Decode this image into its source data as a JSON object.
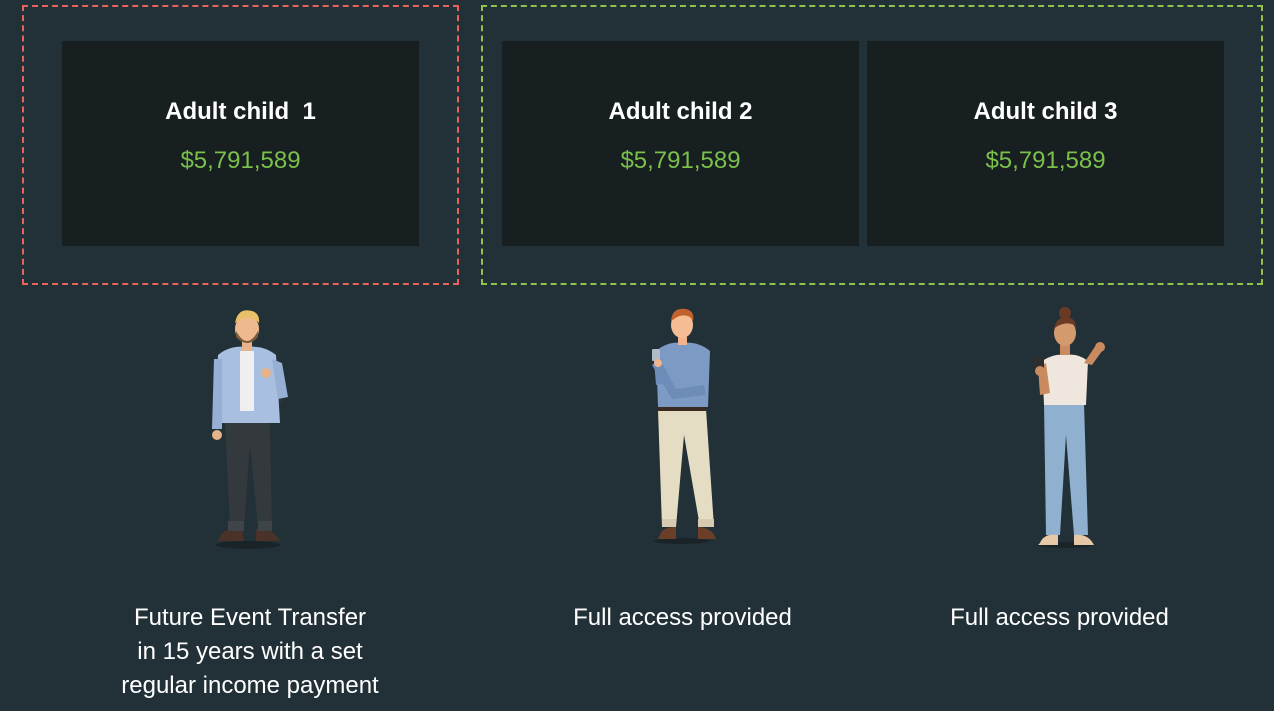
{
  "colors": {
    "background": "#223037",
    "card_background": "#171F21",
    "amount_green": "#7BC04B",
    "dashed_red": "#E8645A",
    "dashed_green": "#92C24A"
  },
  "cards": [
    {
      "title": "Adult child  1",
      "amount": "$5,791,589"
    },
    {
      "title": "Adult child 2",
      "amount": "$5,791,589"
    },
    {
      "title": "Adult child 3",
      "amount": "$5,791,589"
    }
  ],
  "people": [
    {
      "icon": "man-with-backpack-illustration"
    },
    {
      "icon": "man-with-phone-illustration"
    },
    {
      "icon": "woman-with-phone-illustration"
    }
  ],
  "captions": [
    "Future Event Transfer\nin 15 years with a set\nregular income payment",
    "Full access provided",
    "Full access provided"
  ]
}
